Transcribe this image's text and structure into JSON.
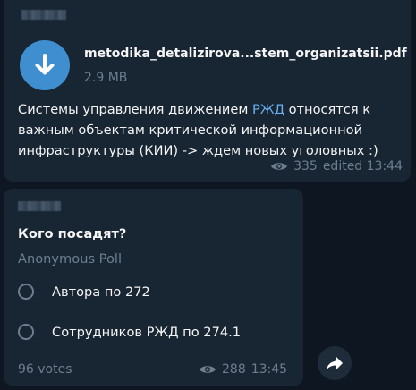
{
  "message1": {
    "file": {
      "name": "metodika_detalizirova...stem_organizatsii.pdf",
      "size": "2.9 MB",
      "icon": "download-icon"
    },
    "text_before": "Системы управления движением ",
    "link": "РЖД",
    "text_after": " относятся к важным объектам критической информационной инфраструктуры (КИИ) -> ждем новых уголовных :)",
    "views": "335",
    "time": "edited 13:44"
  },
  "message2": {
    "poll": {
      "question": "Кого посадят?",
      "type": "Anonymous Poll",
      "options": [
        "Автора по 272",
        "Сотрудников РЖД по 274.1"
      ],
      "votes": "96 votes"
    },
    "views": "288",
    "time": "13:45"
  },
  "icons": {
    "views": "eye-icon",
    "share": "share-arrow-icon"
  },
  "colors": {
    "background": "#0e1621",
    "bubble": "#182533",
    "accent": "#3e8ed0",
    "link": "#6ab2f2",
    "muted": "#6d7f8f"
  }
}
